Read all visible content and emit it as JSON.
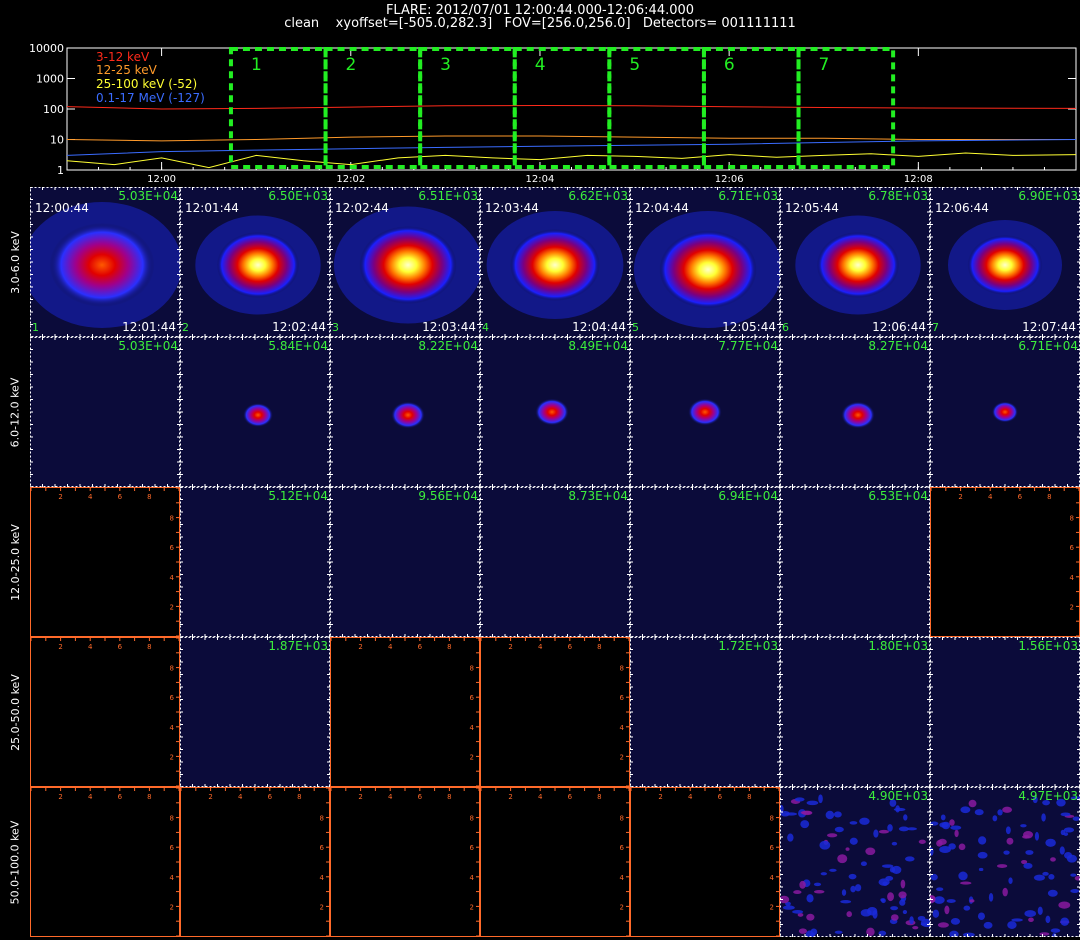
{
  "header": {
    "line1": "FLARE: 2012/07/01 12:00:44.000-12:06:44.000",
    "line2": "clean    xyoffset=[-505.0,282.3]   FOV=[256.0,256.0]   Detectors= 001111111"
  },
  "colors": {
    "red": "#ff2a1a",
    "orange": "#ff9a2a",
    "yellow": "#ffff33",
    "blue": "#3a6cff",
    "green": "#22ee22",
    "panel_bg": "#0b0b3a",
    "grid": "#ffffff",
    "axis_orange": "#ff6a2a"
  },
  "chart_data": [
    {
      "type": "line",
      "title": "",
      "xlabel": "",
      "ylabel": "",
      "x_ticks": [
        "12:00",
        "12:02",
        "12:04",
        "12:06",
        "12:08"
      ],
      "y_ticks": [
        "1",
        "10",
        "100",
        "1000",
        "10000"
      ],
      "ylim": [
        1,
        10000
      ],
      "yscale": "log",
      "xlim": [
        "11:59:00",
        "12:09:40"
      ],
      "interval_labels": [
        "1",
        "2",
        "3",
        "4",
        "5",
        "6",
        "7"
      ],
      "intervals": [
        [
          "12:00:44",
          "12:01:44"
        ],
        [
          "12:01:44",
          "12:02:44"
        ],
        [
          "12:02:44",
          "12:03:44"
        ],
        [
          "12:03:44",
          "12:04:44"
        ],
        [
          "12:04:44",
          "12:05:44"
        ],
        [
          "12:05:44",
          "12:06:44"
        ],
        [
          "12:06:44",
          "12:07:44"
        ]
      ],
      "series": [
        {
          "name": "3-12 keV",
          "color": "#ff2a1a",
          "x": [
            "11:59:00",
            "12:00:00",
            "12:01:00",
            "12:02:00",
            "12:03:00",
            "12:04:00",
            "12:05:00",
            "12:06:00",
            "12:07:00",
            "12:08:00",
            "12:09:40"
          ],
          "values": [
            120,
            100,
            105,
            115,
            128,
            130,
            128,
            118,
            112,
            108,
            105
          ]
        },
        {
          "name": "12-25 keV",
          "color": "#ff9a2a",
          "x": [
            "11:59:00",
            "12:00:00",
            "12:01:00",
            "12:02:00",
            "12:03:00",
            "12:04:00",
            "12:05:00",
            "12:06:00",
            "12:07:00",
            "12:08:00",
            "12:09:40"
          ],
          "values": [
            10,
            9,
            10,
            12,
            13,
            13,
            12,
            11,
            11,
            10,
            10
          ]
        },
        {
          "name": "25-100 keV (-52)",
          "color": "#ffff33",
          "x": [
            "11:59:00",
            "11:59:30",
            "12:00:00",
            "12:00:30",
            "12:01:00",
            "12:01:30",
            "12:02:00",
            "12:02:30",
            "12:03:00",
            "12:03:30",
            "12:04:00",
            "12:04:30",
            "12:05:00",
            "12:05:30",
            "12:06:00",
            "12:06:30",
            "12:07:00",
            "12:07:30",
            "12:08:00",
            "12:08:30",
            "12:09:00",
            "12:09:40"
          ],
          "values": [
            2,
            1.5,
            2.5,
            1.2,
            3,
            2,
            1.5,
            2.5,
            3,
            2.5,
            2.2,
            3,
            2.8,
            2.4,
            3.2,
            2.6,
            3,
            3.4,
            2.8,
            3.6,
            3.0,
            3.2
          ]
        },
        {
          "name": "0.1-17 MeV (-127)",
          "color": "#3a6cff",
          "x": [
            "11:59:00",
            "12:00:00",
            "12:01:00",
            "12:02:00",
            "12:03:00",
            "12:04:00",
            "12:05:00",
            "12:06:00",
            "12:07:00",
            "12:08:00",
            "12:09:40"
          ],
          "values": [
            3,
            4,
            4.5,
            5,
            5.5,
            6,
            6.5,
            7,
            8,
            9,
            10
          ]
        }
      ]
    },
    {
      "type": "heatmap",
      "energy_bands": [
        "3.0-6.0 keV",
        "6.0-12.0 keV",
        "12.0-25.0 keV",
        "25.0-50.0 keV",
        "50.0-100.0 keV"
      ],
      "panels": [
        [
          {
            "peak": "5.03E+04",
            "t0": "12:00:44",
            "t1": "12:01:44",
            "idx": "1",
            "src": {
              "cx": 0.48,
              "cy": 0.52,
              "r": 0.28,
              "intensity": 0.75
            }
          },
          {
            "peak": "6.50E+03",
            "t0": "12:01:44",
            "t1": "12:02:44",
            "idx": "2",
            "src": {
              "cx": 0.52,
              "cy": 0.52,
              "r": 0.22,
              "intensity": 1.0
            }
          },
          {
            "peak": "6.51E+03",
            "t0": "12:02:44",
            "t1": "12:03:44",
            "idx": "3",
            "src": {
              "cx": 0.52,
              "cy": 0.52,
              "r": 0.26,
              "intensity": 1.0
            }
          },
          {
            "peak": "6.62E+03",
            "t0": "12:03:44",
            "t1": "12:04:44",
            "idx": "4",
            "src": {
              "cx": 0.5,
              "cy": 0.52,
              "r": 0.24,
              "intensity": 1.0
            }
          },
          {
            "peak": "6.71E+03",
            "t0": "12:04:44",
            "t1": "12:05:44",
            "idx": "5",
            "src": {
              "cx": 0.52,
              "cy": 0.55,
              "r": 0.26,
              "intensity": 1.0
            }
          },
          {
            "peak": "6.78E+03",
            "t0": "12:05:44",
            "t1": "12:06:44",
            "idx": "6",
            "src": {
              "cx": 0.52,
              "cy": 0.52,
              "r": 0.22,
              "intensity": 1.0
            }
          },
          {
            "peak": "6.90E+03",
            "t0": "12:06:44",
            "t1": "12:07:44",
            "idx": "7",
            "src": {
              "cx": 0.5,
              "cy": 0.52,
              "r": 0.2,
              "intensity": 1.0
            }
          }
        ],
        [
          {
            "peak": "5.03E+04",
            "src": null
          },
          {
            "peak": "5.84E+04",
            "src": {
              "cx": 0.52,
              "cy": 0.52,
              "r": 0.08,
              "intensity": 0.8
            }
          },
          {
            "peak": "8.22E+04",
            "src": {
              "cx": 0.52,
              "cy": 0.52,
              "r": 0.09,
              "intensity": 0.9
            }
          },
          {
            "peak": "8.49E+04",
            "src": {
              "cx": 0.48,
              "cy": 0.5,
              "r": 0.09,
              "intensity": 0.85
            }
          },
          {
            "peak": "7.77E+04",
            "src": {
              "cx": 0.5,
              "cy": 0.5,
              "r": 0.09,
              "intensity": 0.8
            }
          },
          {
            "peak": "8.27E+04",
            "src": {
              "cx": 0.52,
              "cy": 0.52,
              "r": 0.09,
              "intensity": 0.8
            }
          },
          {
            "peak": "6.71E+04",
            "src": {
              "cx": 0.5,
              "cy": 0.5,
              "r": 0.07,
              "intensity": 0.7
            }
          }
        ],
        [
          {
            "blank": true
          },
          {
            "peak": "5.12E+04",
            "src": null
          },
          {
            "peak": "9.56E+04",
            "src": null
          },
          {
            "peak": "8.73E+04",
            "src": null
          },
          {
            "peak": "6.94E+04",
            "src": null
          },
          {
            "peak": "6.53E+04",
            "src": null
          },
          {
            "blank": true
          }
        ],
        [
          {
            "blank": true
          },
          {
            "peak": "1.87E+03",
            "src": null
          },
          {
            "blank": true
          },
          {
            "blank": true
          },
          {
            "peak": "1.72E+03",
            "src": null
          },
          {
            "peak": "1.80E+03",
            "src": null
          },
          {
            "peak": "1.56E+03",
            "src": null
          }
        ],
        [
          {
            "blank": true
          },
          {
            "blank": true
          },
          {
            "blank": true
          },
          {
            "blank": true
          },
          {
            "blank": true
          },
          {
            "peak": "4.90E+03",
            "src": null,
            "noise": true
          },
          {
            "peak": "4.97E+03",
            "src": null,
            "noise": true
          }
        ]
      ],
      "blank_panel_ticks": [
        "2",
        "4",
        "6",
        "8"
      ]
    }
  ]
}
